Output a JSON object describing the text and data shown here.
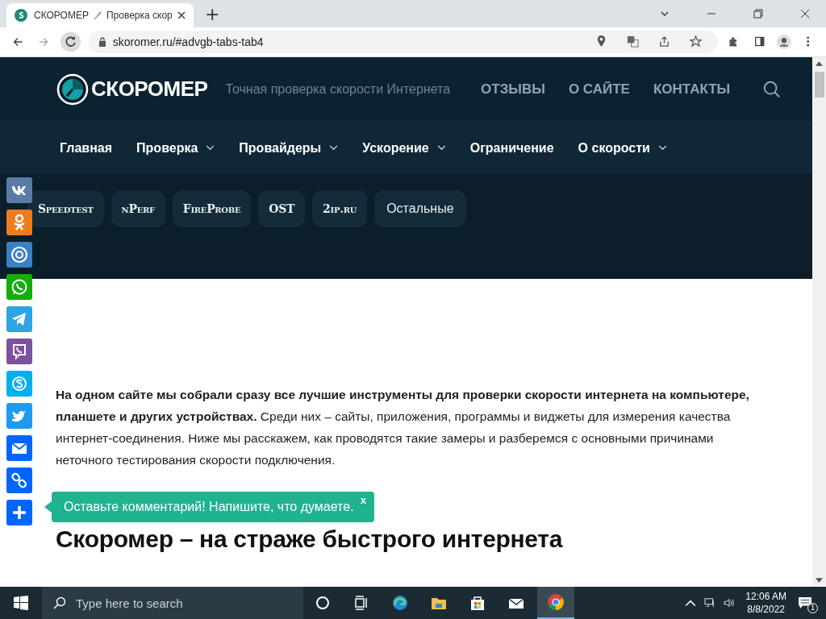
{
  "browser": {
    "tab_title": "СКОРОМЕР",
    "tab_title_rest": "Проверка скор",
    "new_tab": "+",
    "url": "skoromer.ru/#advgb-tabs-tab4"
  },
  "header": {
    "logo": "СКОРОМЕР",
    "tagline": "Точная проверка скорости Интернета",
    "links": [
      "ОТЗЫВЫ",
      "О САЙТЕ",
      "КОНТАКТЫ"
    ]
  },
  "nav": [
    {
      "label": "Главная",
      "has_dropdown": false
    },
    {
      "label": "Проверка",
      "has_dropdown": true
    },
    {
      "label": "Провайдеры",
      "has_dropdown": true
    },
    {
      "label": "Ускорение",
      "has_dropdown": true
    },
    {
      "label": "Ограничение",
      "has_dropdown": false
    },
    {
      "label": "О скорости",
      "has_dropdown": true
    }
  ],
  "service_tabs": [
    {
      "label": "Speedtest",
      "kind": "fancy"
    },
    {
      "label": "nPerf",
      "kind": "fancy"
    },
    {
      "label": "FireProbe",
      "kind": "fancy"
    },
    {
      "label": "OST",
      "kind": "fancy"
    },
    {
      "label": "2ip.ru",
      "kind": "fancy"
    },
    {
      "label": "Остальные",
      "kind": "plain"
    }
  ],
  "share_bar": [
    {
      "kind": "vk",
      "color": "#587ca3"
    },
    {
      "kind": "ok",
      "color": "#ed7c1c"
    },
    {
      "kind": "mailru",
      "color": "#3b7fc4"
    },
    {
      "kind": "whatsapp",
      "color": "#12af0a"
    },
    {
      "kind": "telegram",
      "color": "#2ca5e0"
    },
    {
      "kind": "viber",
      "color": "#7c529e"
    },
    {
      "kind": "skype",
      "color": "#00aff0"
    },
    {
      "kind": "twitter",
      "color": "#1d9bf0"
    },
    {
      "kind": "email",
      "color": "#0166ff"
    },
    {
      "kind": "link",
      "color": "#0166ff"
    },
    {
      "kind": "share",
      "color": "#0166ff"
    }
  ],
  "intro": "**На одном сайте мы собрали сразу все лучшие инструменты для проверки скорости интернета на компьютере, планшете и других устройствах.** Среди них – сайты, приложения, программы и виджеты для измерения качества интернет-соединения. Ниже мы расскажем, как проводятся такие замеры и разберемся с основными причинами неточного тестирования скорости подключения.",
  "comment_prompt": {
    "text": "Оставьте комментарий! Напишите, что думаете.",
    "close": "x"
  },
  "heading": "Скоромер – на страже быстрого интернета",
  "taskbar": {
    "search_placeholder": "Type here to search",
    "time": "12:06 AM",
    "date": "8/8/2022",
    "notifications": "1"
  }
}
